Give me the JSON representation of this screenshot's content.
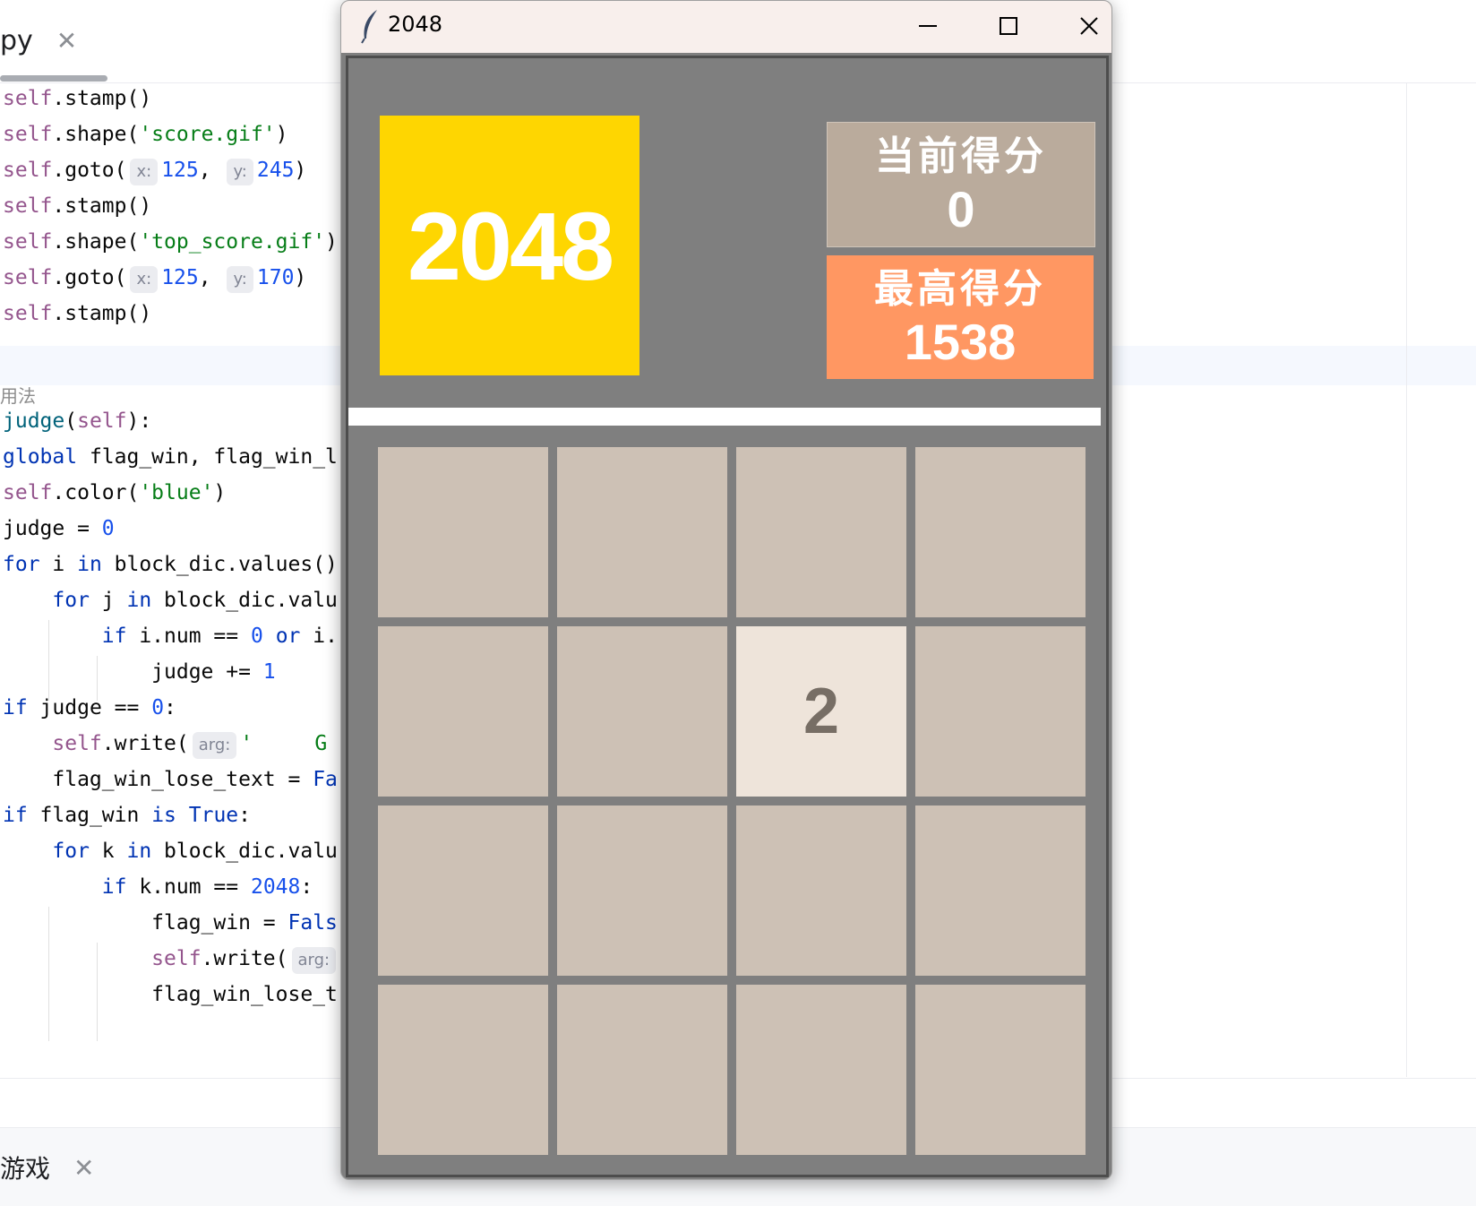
{
  "ide": {
    "file_tab": {
      "name": "py",
      "close": "✕"
    },
    "comment_text": "用法",
    "run_tab": {
      "name": "游戏",
      "close": "✕"
    }
  },
  "window": {
    "title": "2048",
    "icon": "feather-icon",
    "controls": {
      "minimize": "—",
      "maximize": "☐",
      "close": "✕"
    }
  },
  "game": {
    "logo_text": "2048",
    "current_score": {
      "label": "当前得分",
      "value": "0"
    },
    "best_score": {
      "label": "最高得分",
      "value": "1538"
    },
    "board": [
      [
        "",
        "",
        "",
        ""
      ],
      [
        "",
        "",
        "2",
        ""
      ],
      [
        "",
        "",
        "",
        ""
      ],
      [
        "",
        "",
        "",
        ""
      ]
    ]
  },
  "colors": {
    "logo_bg": "#fed601",
    "current_score_bg": "#baab9c",
    "best_score_bg": "#ff9762",
    "empty_cell": "#cdc1b5",
    "tile_2": "#eee4da",
    "board_bg": "#7f7f7f"
  }
}
